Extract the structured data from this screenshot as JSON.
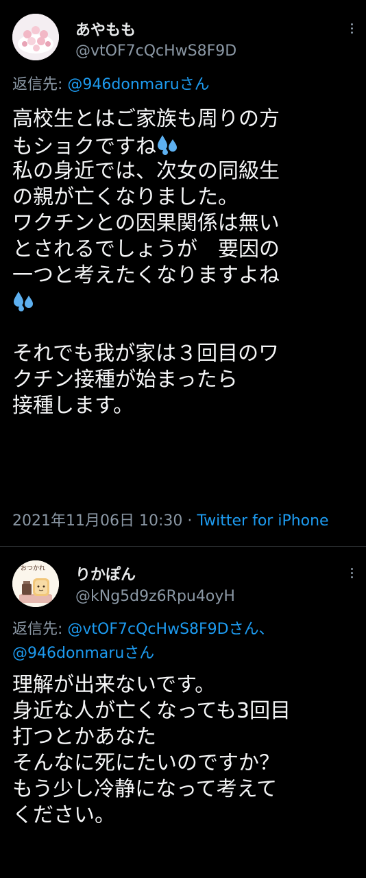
{
  "tweets": [
    {
      "display_name": "あやもも",
      "handle": "@vtOF7cQcHwS8F9D",
      "reply_prefix": "返信先: ",
      "reply_mentions": [
        "@946donmaru"
      ],
      "reply_suffix": "さん",
      "lines": [
        "高校生とはご家族も周りの方",
        "もショクですね",
        "私の身近では、次女の同級生",
        "の親が亡くなりました。",
        "ワクチンとの因果関係は無い",
        "とされるでしょうが　要因の",
        "一つと考えたくなりますよね",
        "",
        "",
        "それでも我が家は３回目のワ",
        "クチン接種が始まったら",
        "接種します。"
      ],
      "emoji": "sweat-droplets",
      "timestamp": "2021年11月06日 10:30",
      "separator": " · ",
      "client": "Twitter for iPhone"
    },
    {
      "display_name": "りかぽん",
      "handle": "@kNg5d9z6Rpu4oyH",
      "reply_prefix": "返信先: ",
      "reply_line1": "@vtOF7cQcHwS8F9D",
      "reply_line1_suffix": "さん、",
      "reply_line2": "@946donmaru",
      "reply_line2_suffix": "さん",
      "avatar_text": "おつかれ",
      "lines": [
        "理解が出来ないです。",
        "身近な人が亡くなっても3回目",
        "打つとかあなた",
        "そんなに死にたいのですか？",
        "もう少し冷静になって考えて",
        "ください。"
      ]
    }
  ],
  "colors": {
    "background": "#000000",
    "text": "#e7e9ea",
    "secondary": "#8b98a5",
    "accent": "#1d9bf0",
    "divider": "#2f3336"
  }
}
